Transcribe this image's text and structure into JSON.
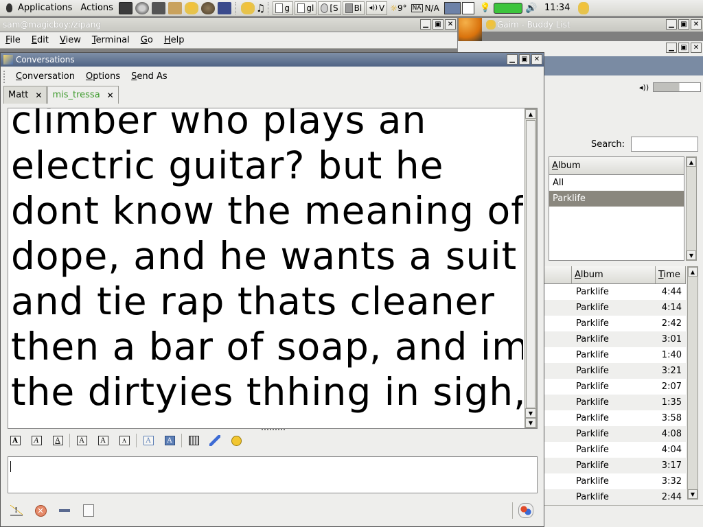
{
  "panel": {
    "menus": [
      "Applications",
      "Actions"
    ],
    "tasks": [
      {
        "label": "g"
      },
      {
        "label": "gl"
      },
      {
        "label": "[S"
      },
      {
        "label": "Bl"
      },
      {
        "label": "V"
      }
    ],
    "weather": "9°",
    "network": "N/A",
    "clock": "11:34"
  },
  "terminal": {
    "title": "sam@magicboy:/zipang",
    "menu": [
      "File",
      "Edit",
      "View",
      "Terminal",
      "Go",
      "Help"
    ]
  },
  "buddy_list": {
    "title": "Gaim - Buddy List"
  },
  "music": {
    "search_label": "Search:",
    "album_header": "Album",
    "albums": [
      "All",
      "Parklife"
    ],
    "selected_album": "Parklife",
    "track_columns": [
      "Album",
      "Time"
    ],
    "tracks": [
      {
        "album": "Parklife",
        "time": "4:44"
      },
      {
        "album": "Parklife",
        "time": "4:14"
      },
      {
        "album": "Parklife",
        "time": "2:42"
      },
      {
        "album": "Parklife",
        "time": "3:01"
      },
      {
        "album": "Parklife",
        "time": "1:40"
      },
      {
        "album": "Parklife",
        "time": "3:21"
      },
      {
        "album": "Parklife",
        "time": "2:07"
      },
      {
        "album": "Parklife",
        "time": "1:35"
      },
      {
        "album": "Parklife",
        "time": "3:58"
      },
      {
        "album": "Parklife",
        "time": "4:08"
      },
      {
        "album": "Parklife",
        "time": "4:04"
      },
      {
        "album": "Parklife",
        "time": "3:17"
      },
      {
        "album": "Parklife",
        "time": "3:32"
      },
      {
        "album": "Parklife",
        "time": "2:44"
      }
    ]
  },
  "conversations": {
    "title": "Conversations",
    "menu": [
      "Conversation",
      "Options",
      "Send As"
    ],
    "tabs": [
      {
        "label": "Matt",
        "active": false
      },
      {
        "label": "mis_tressa",
        "active": true
      }
    ],
    "log_lines": [
      "climber who plays an",
      "electric guitar? but he",
      "dont know the meaning of",
      "dope, and he wants a suit",
      "and tie rap thats cleaner",
      "then a bar of soap, and im",
      "the dirtyies thhing in sigh,"
    ],
    "input_value": ""
  },
  "colors": {
    "active_title": "#4f6384",
    "selected_row": "#8a877e",
    "active_tab_text": "#3d9a2c",
    "battery": "#3cc43c"
  }
}
